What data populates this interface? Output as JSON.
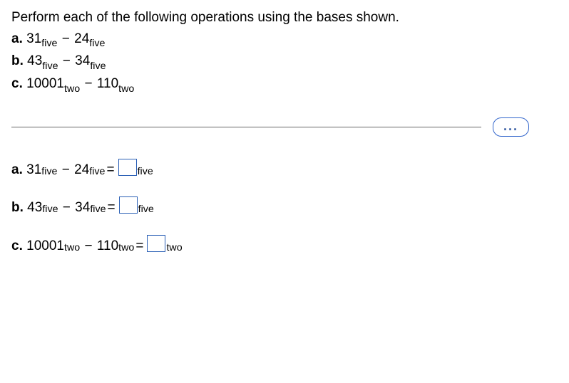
{
  "instruction": "Perform each of the following operations using the bases shown.",
  "problems": [
    {
      "label": "a.",
      "a_val": "31",
      "a_base": "five",
      "b_val": "24",
      "b_base": "five"
    },
    {
      "label": "b.",
      "a_val": "43",
      "a_base": "five",
      "b_val": "34",
      "b_base": "five"
    },
    {
      "label": "c.",
      "a_val": "10001",
      "a_base": "two",
      "b_val": "110",
      "b_base": "two"
    }
  ],
  "answers": [
    {
      "label": "a.",
      "a_val": "31",
      "a_base": "five",
      "b_val": "24",
      "b_base": "five",
      "ans_base": "five"
    },
    {
      "label": "b.",
      "a_val": "43",
      "a_base": "five",
      "b_val": "34",
      "b_base": "five",
      "ans_base": "five"
    },
    {
      "label": "c.",
      "a_val": "10001",
      "a_base": "two",
      "b_val": "110",
      "b_base": "two",
      "ans_base": "two"
    }
  ],
  "symbols": {
    "minus": "−",
    "equals": "=",
    "dots": "..."
  }
}
